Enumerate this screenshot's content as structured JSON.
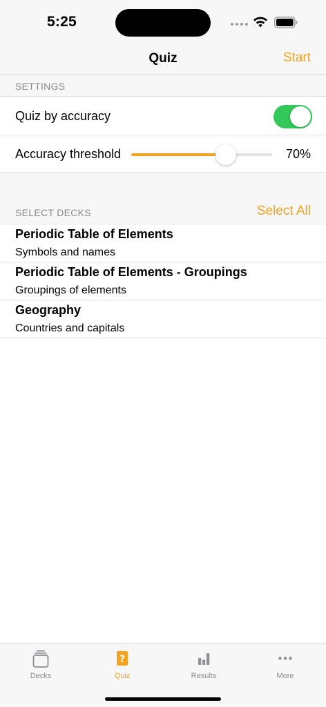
{
  "status_bar": {
    "time": "5:25"
  },
  "nav": {
    "title": "Quiz",
    "start_label": "Start"
  },
  "settings": {
    "header": "SETTINGS",
    "quiz_by_accuracy_label": "Quiz by accuracy",
    "quiz_by_accuracy_on": true,
    "accuracy_label": "Accuracy threshold",
    "accuracy_value_text": "70%",
    "accuracy_fraction": 0.7
  },
  "decks": {
    "header": "SELECT DECKS",
    "select_all_label": "Select All",
    "items": [
      {
        "title": "Periodic Table of Elements",
        "subtitle": "Symbols and names"
      },
      {
        "title": "Periodic Table of Elements - Groupings",
        "subtitle": "Groupings of elements"
      },
      {
        "title": "Geography",
        "subtitle": "Countries and capitals"
      }
    ]
  },
  "tabs": [
    {
      "label": "Decks",
      "icon": "decks-icon",
      "active": false
    },
    {
      "label": "Quiz",
      "icon": "quiz-icon",
      "active": true
    },
    {
      "label": "Results",
      "icon": "results-icon",
      "active": false
    },
    {
      "label": "More",
      "icon": "more-icon",
      "active": false
    }
  ],
  "colors": {
    "accent": "#f2a321",
    "toggle_on": "#34c759",
    "inactive": "#8e8e93"
  }
}
